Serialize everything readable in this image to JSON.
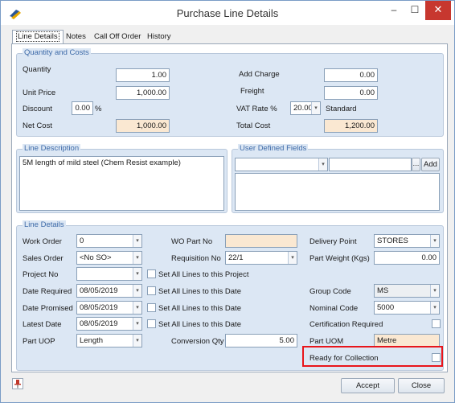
{
  "window": {
    "title": "Purchase Line Details",
    "minimize": "–",
    "maximize": "☐",
    "close": "✕"
  },
  "tabs": [
    "Line Details",
    "Notes",
    "Call Off Order",
    "History"
  ],
  "qty_costs": {
    "title": "Quantity and Costs",
    "quantity_label": "Quantity",
    "quantity": "1.00",
    "unit_price_label": "Unit Price",
    "unit_price": "1,000.00",
    "discount_label": "Discount",
    "discount": "0.00",
    "discount_unit": "%",
    "net_cost_label": "Net Cost",
    "net_cost": "1,000.00",
    "add_charge_label": "Add Charge",
    "add_charge": "0.00",
    "freight_label": "Freight",
    "freight": "0.00",
    "vat_rate_label": "VAT Rate %",
    "vat_rate": "20.00",
    "vat_type": "Standard",
    "total_cost_label": "Total Cost",
    "total_cost": "1,200.00"
  },
  "line_description": {
    "title": "Line Description",
    "text": "5M length of mild steel (Chem Resist example)"
  },
  "user_fields": {
    "title": "User Defined Fields",
    "ellipsis": "...",
    "add_label": "Add"
  },
  "line_details": {
    "title": "Line Details",
    "work_order_label": "Work Order",
    "work_order": "0",
    "sales_order_label": "Sales Order",
    "sales_order": "<No SO>",
    "project_no_label": "Project No",
    "project_no": "",
    "set_project_label": "Set All Lines to this Project",
    "date_required_label": "Date Required",
    "date_required": "08/05/2019",
    "date_promised_label": "Date Promised",
    "date_promised": "08/05/2019",
    "latest_date_label": "Latest Date",
    "latest_date": "08/05/2019",
    "set_date_label": "Set All Lines to this Date",
    "part_uop_label": "Part UOP",
    "part_uop": "Length",
    "wo_part_label": "WO Part No",
    "wo_part": "",
    "requisition_label": "Requisition No",
    "requisition": "22/1",
    "conversion_label": "Conversion Qty",
    "conversion": "5.00",
    "delivery_point_label": "Delivery Point",
    "delivery_point": "STORES",
    "part_weight_label": "Part Weight (Kgs)",
    "part_weight": "0.00",
    "group_code_label": "Group Code",
    "group_code": "MS",
    "nominal_code_label": "Nominal Code",
    "nominal_code": "5000",
    "certification_label": "Certification Required",
    "part_uom_label": "Part UOM",
    "part_uom": "Metre",
    "ready_label": "Ready for Collection"
  },
  "footer": {
    "accept": "Accept",
    "close": "Close"
  }
}
